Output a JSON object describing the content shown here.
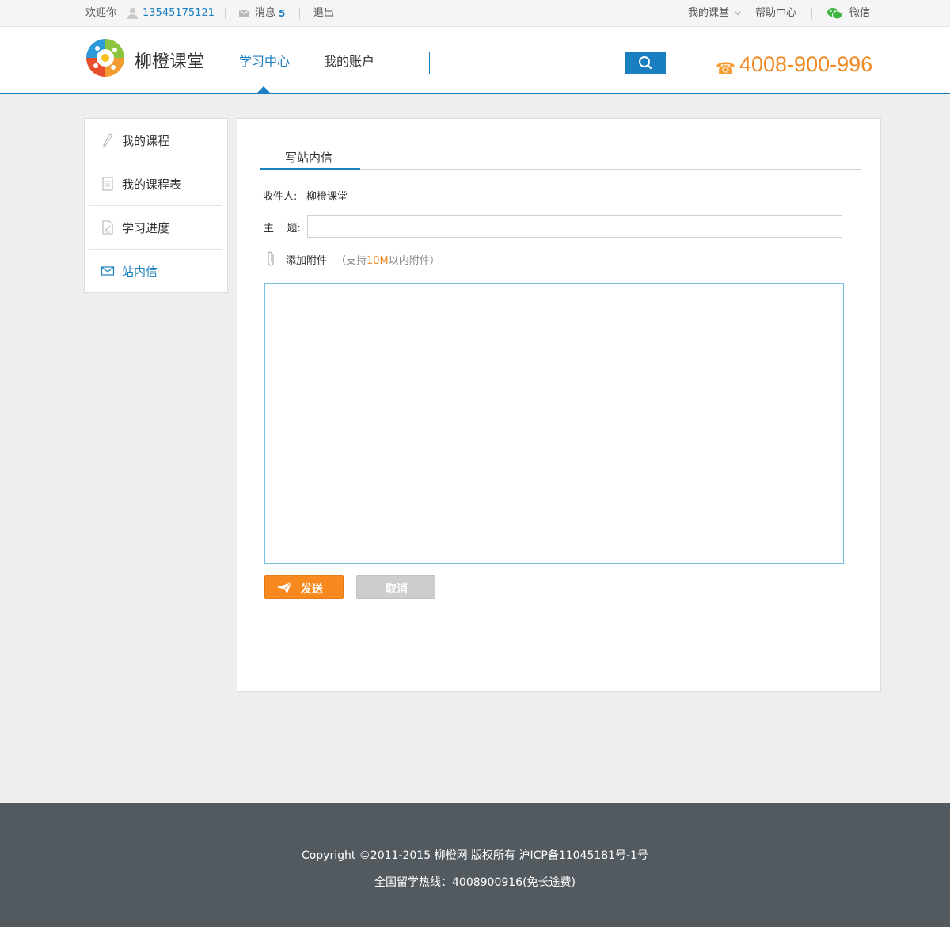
{
  "topbar": {
    "welcome": "欢迎你",
    "phone_user": "13545175121",
    "messages_label": "消息",
    "messages_count": "5",
    "logout": "退出",
    "my_classroom": "我的课堂",
    "help_center": "帮助中心",
    "wechat": "微信"
  },
  "header": {
    "brand": "柳橙课堂",
    "nav": [
      {
        "label": "学习中心",
        "active": true
      },
      {
        "label": "我的账户",
        "active": false
      }
    ],
    "search_placeholder": "",
    "hotline": "4008-900-996"
  },
  "sidebar": {
    "items": [
      {
        "label": "我的课程",
        "icon": "pen-icon",
        "active": false
      },
      {
        "label": "我的课程表",
        "icon": "document-icon",
        "active": false
      },
      {
        "label": "学习进度",
        "icon": "edit-note-icon",
        "active": false
      },
      {
        "label": "站内信",
        "icon": "envelope-icon",
        "active": true
      }
    ]
  },
  "main": {
    "tab": "写站内信",
    "recipient_label": "收件人:",
    "recipient_value": "柳橙课堂",
    "subject_label": "主    题:",
    "subject_value": "",
    "attach_label": "添加附件",
    "attach_hint_pre": "（支持",
    "attach_hint_size": "10M",
    "attach_hint_post": "以内附件）",
    "message_value": "",
    "send_label": "发送",
    "cancel_label": "取消"
  },
  "footer": {
    "copyright": "Copyright ©2011-2015 柳橙网 版权所有 沪ICP备11045181号-1号",
    "hotline": "全国留学热线：4008900916(免长途费)"
  },
  "colors": {
    "accent": "#1a7fc1",
    "orange": "#f08a24",
    "footer_bg": "#525a60"
  }
}
